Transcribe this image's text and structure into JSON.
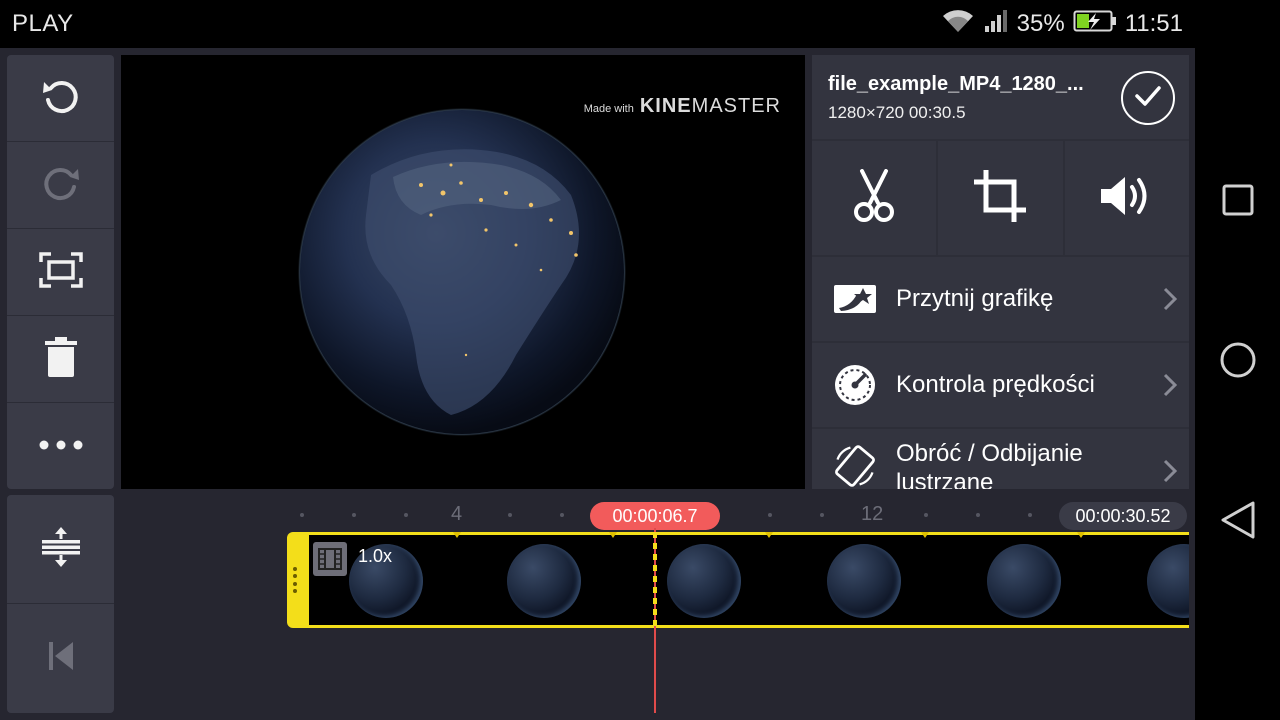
{
  "status_bar": {
    "app_name": "PLAY",
    "battery_percent": "35%",
    "time": "11:51",
    "icons": [
      "wifi-icon",
      "signal-icon",
      "battery-charging-icon"
    ]
  },
  "side_tools": {
    "buttons": [
      "undo-icon",
      "redo-icon",
      "fullscreen-icon",
      "delete-icon",
      "more-icon"
    ],
    "bottom_buttons": [
      "timeline-expand-icon",
      "skip-to-start-icon"
    ]
  },
  "preview": {
    "watermark_prefix": "Made with",
    "watermark_brand_1": "KINE",
    "watermark_brand_2": "MASTER"
  },
  "panel": {
    "file_name": "file_example_MP4_1280_...",
    "file_meta": "1280×720  00:30.5",
    "tools": [
      "scissors-icon",
      "crop-icon",
      "volume-icon"
    ],
    "menu": [
      {
        "label": "Przytnij grafikę",
        "icon": "trim-graphic-icon"
      },
      {
        "label": "Kontrola prędkości",
        "icon": "speedometer-icon"
      },
      {
        "label": "Obróć / Odbijanie lustrzane",
        "icon": "rotate-icon"
      }
    ]
  },
  "timeline": {
    "ruler_labels": [
      "4",
      "12"
    ],
    "playhead_time": "00:00:06.7",
    "total_time": "00:00:30.52",
    "clip_speed": "1.0x"
  },
  "colors": {
    "accent_yellow": "#f3de1a",
    "playhead_red": "#f25b5b",
    "panel_bg": "#33343f",
    "app_bg": "#262630"
  }
}
